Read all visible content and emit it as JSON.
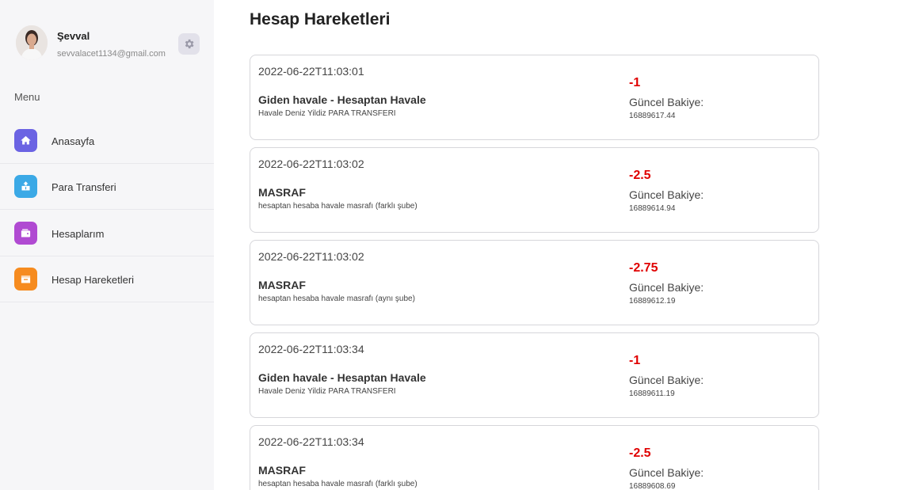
{
  "user": {
    "name": "Şevval",
    "email": "sevvalacet1134@gmail.com"
  },
  "sidebar": {
    "menu_label": "Menu",
    "items": [
      {
        "label": "Anasayfa",
        "icon": "home-icon",
        "color": "#6b63e3"
      },
      {
        "label": "Para Transferi",
        "icon": "transfer-icon",
        "color": "#3ba9e6"
      },
      {
        "label": "Hesaplarım",
        "icon": "wallet-icon",
        "color": "#b04ad2"
      },
      {
        "label": "Hesap Hareketleri",
        "icon": "calendar-icon",
        "color": "#f68b1f"
      }
    ]
  },
  "main": {
    "title": "Hesap Hareketleri",
    "balance_label": "Güncel Bakiye:",
    "transactions": [
      {
        "date": "2022-06-22T11:03:01",
        "title": "Giden havale - Hesaptan Havale",
        "description": "Havale Deniz Yildiz PARA TRANSFERI",
        "amount": "-1",
        "balance": "16889617.44"
      },
      {
        "date": "2022-06-22T11:03:02",
        "title": "MASRAF",
        "description": "hesaptan hesaba havale masrafı (farklı şube)",
        "amount": "-2.5",
        "balance": "16889614.94"
      },
      {
        "date": "2022-06-22T11:03:02",
        "title": "MASRAF",
        "description": "hesaptan hesaba havale masrafı (aynı şube)",
        "amount": "-2.75",
        "balance": "16889612.19"
      },
      {
        "date": "2022-06-22T11:03:34",
        "title": "Giden havale - Hesaptan Havale",
        "description": "Havale Deniz Yildiz PARA TRANSFERI",
        "amount": "-1",
        "balance": "16889611.19"
      },
      {
        "date": "2022-06-22T11:03:34",
        "title": "MASRAF",
        "description": "hesaptan hesaba havale masrafı (farklı şube)",
        "amount": "-2.5",
        "balance": "16889608.69"
      }
    ]
  },
  "colors": {
    "negative_amount": "#e00000",
    "sidebar_bg": "#f6f6f8"
  }
}
